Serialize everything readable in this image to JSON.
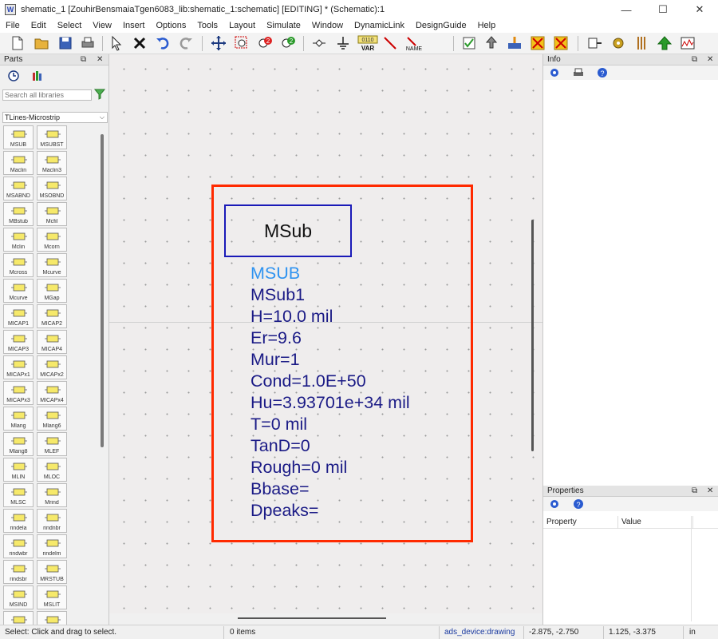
{
  "window": {
    "title": "shematic_1 [ZouhirBensmaiaTgen6083_lib:shematic_1:schematic] [EDITING] * (Schematic):1",
    "app_icon_text": "W",
    "minimize": "—",
    "maximize": "☐",
    "close": "✕"
  },
  "menu": [
    "File",
    "Edit",
    "Select",
    "View",
    "Insert",
    "Options",
    "Tools",
    "Layout",
    "Simulate",
    "Window",
    "DynamicLink",
    "DesignGuide",
    "Help"
  ],
  "toolbar": {
    "var_label": "VAR",
    "var_digits": "0110",
    "name_label": "NAME"
  },
  "parts_panel": {
    "title": "Parts",
    "float_icon": "⧉",
    "close_icon": "✕",
    "search_placeholder": "Search all libraries",
    "library": "TLines-Microstrip",
    "items": [
      {
        "label": "MSUB",
        "icon": "msub-icon"
      },
      {
        "label": "MSUBST",
        "icon": "msubst-icon"
      },
      {
        "label": "Maclin",
        "icon": "maclin-icon"
      },
      {
        "label": "Maclin3",
        "icon": "maclin3-icon"
      },
      {
        "label": "MSABND",
        "icon": "msabnd-icon"
      },
      {
        "label": "MSOBND",
        "icon": "msobnd-icon"
      },
      {
        "label": "MBstub",
        "icon": "mbstub-icon"
      },
      {
        "label": "Mcfil",
        "icon": "mcfil-icon"
      },
      {
        "label": "Mclin",
        "icon": "mclin-icon"
      },
      {
        "label": "Mcorn",
        "icon": "mcorn-icon"
      },
      {
        "label": "Mcross",
        "icon": "mcross-icon"
      },
      {
        "label": "Mcurve",
        "icon": "mcurve-icon"
      },
      {
        "label": "Mcurve",
        "icon": "mcurve2-icon"
      },
      {
        "label": "MGap",
        "icon": "mgap-icon"
      },
      {
        "label": "MICAP1",
        "icon": "micap1-icon"
      },
      {
        "label": "MICAP2",
        "icon": "micap2-icon"
      },
      {
        "label": "MICAP3",
        "icon": "micap3-icon"
      },
      {
        "label": "MICAP4",
        "icon": "micap4-icon"
      },
      {
        "label": "MICAPx1",
        "icon": "micapx1-icon"
      },
      {
        "label": "MICAPx2",
        "icon": "micapx2-icon"
      },
      {
        "label": "MICAPx3",
        "icon": "micapx3-icon"
      },
      {
        "label": "MICAPx4",
        "icon": "micapx4-icon"
      },
      {
        "label": "Mlang",
        "icon": "mlang-icon"
      },
      {
        "label": "Mlang6",
        "icon": "mlang6-icon"
      },
      {
        "label": "Mlang8",
        "icon": "mlang8-icon"
      },
      {
        "label": "MLEF",
        "icon": "mlef-icon"
      },
      {
        "label": "MLIN",
        "icon": "mlin-icon"
      },
      {
        "label": "MLOC",
        "icon": "mloc-icon"
      },
      {
        "label": "MLSC",
        "icon": "mlsc-icon"
      },
      {
        "label": "Mrind",
        "icon": "mrind-icon"
      },
      {
        "label": "rindela",
        "icon": "rindela-icon"
      },
      {
        "label": "rindnbr",
        "icon": "rindnbr-icon"
      },
      {
        "label": "rindwbr",
        "icon": "rindwbr-icon"
      },
      {
        "label": "rindelm",
        "icon": "rindelm-icon"
      },
      {
        "label": "rindsbr",
        "icon": "rindsbr-icon"
      },
      {
        "label": "MRSTUB",
        "icon": "mrstub-icon"
      },
      {
        "label": "MSIND",
        "icon": "msind-icon"
      },
      {
        "label": "MSLIT",
        "icon": "mslit-icon"
      },
      {
        "label": "",
        "icon": "mstep-icon"
      },
      {
        "label": "",
        "icon": "mtee-icon"
      }
    ]
  },
  "schematic": {
    "symbol_label": "MSub",
    "component_name": "MSUB",
    "params": [
      "MSub1",
      "H=10.0 mil",
      "Er=9.6",
      "Mur=1",
      "Cond=1.0E+50",
      "Hu=3.93701e+34 mil",
      "T=0 mil",
      "TanD=0",
      "Rough=0 mil",
      "Bbase=",
      "Dpeaks="
    ]
  },
  "info_panel": {
    "title": "Info",
    "float_icon": "⧉",
    "close_icon": "✕"
  },
  "properties_panel": {
    "title": "Properties",
    "float_icon": "⧉",
    "close_icon": "✕",
    "columns": [
      "Property",
      "Value"
    ]
  },
  "status": {
    "hint": "Select: Click and drag to select.",
    "items": "0 items",
    "layer": "ads_device:drawing",
    "coord1": "-2.875, -2.750",
    "coord2": "1.125, -3.375",
    "units": "in"
  },
  "colors": {
    "selection": "#ff2a00",
    "symbol_border": "#1a1ab8",
    "param_text": "#1b1b86",
    "component_name": "#2f93f0"
  }
}
